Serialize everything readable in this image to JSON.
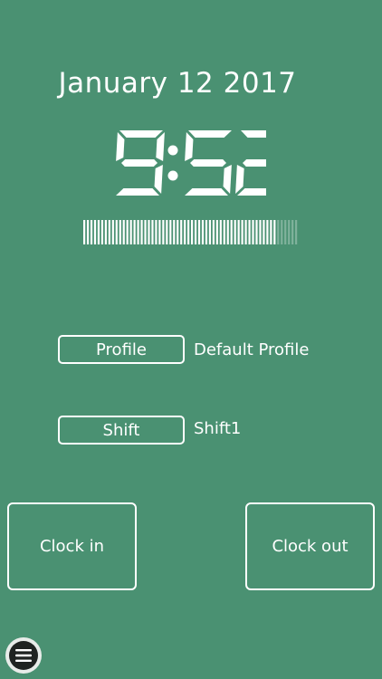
{
  "header": {
    "date": "January 12 2017"
  },
  "clock": {
    "time": "9:52",
    "seconds_progress": 0.9
  },
  "profile": {
    "button_label": "Profile",
    "value": "Default Profile"
  },
  "shift": {
    "button_label": "Shift",
    "value": "Shift1"
  },
  "actions": {
    "clock_in_label": "Clock in",
    "clock_out_label": "Clock out"
  },
  "menu": {
    "icon": "hamburger-menu-icon"
  },
  "colors": {
    "background": "#4a9172",
    "foreground": "#ffffff"
  }
}
